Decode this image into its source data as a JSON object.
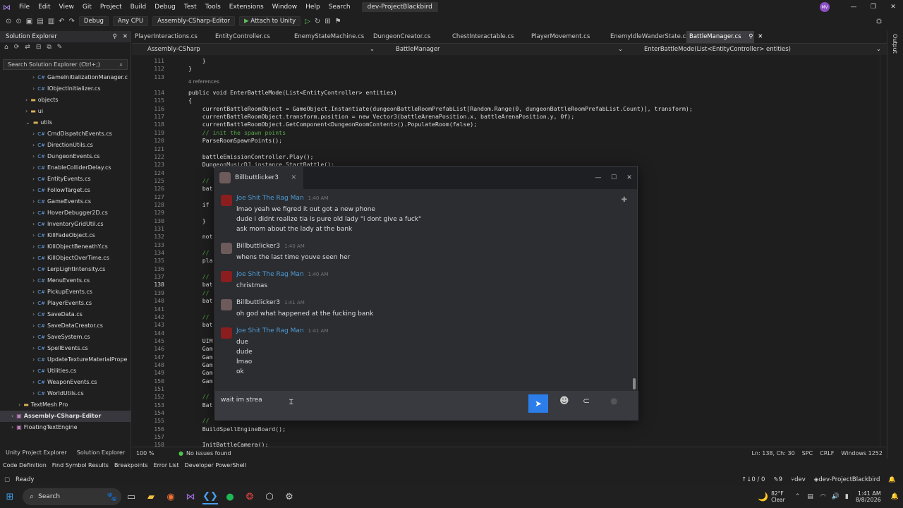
{
  "menu": [
    "File",
    "Edit",
    "View",
    "Git",
    "Project",
    "Build",
    "Debug",
    "Test",
    "Tools",
    "Extensions",
    "Window",
    "Help",
    "Search"
  ],
  "window": {
    "title": "dev-ProjectBlackbird",
    "avatar": "MV"
  },
  "toolbar": {
    "config": "Debug",
    "platform": "Any CPU",
    "project": "Assembly-CSharp-Editor",
    "attach": "Attach to Unity"
  },
  "explorer": {
    "title": "Solution Explorer",
    "search_placeholder": "Search Solution Explorer (Ctrl+;)",
    "items": [
      {
        "label": "GameInitializationManager.c",
        "kind": "cs",
        "indent": 4
      },
      {
        "label": "IObjectInitializer.cs",
        "kind": "cs",
        "indent": 4
      },
      {
        "label": "objects",
        "kind": "folder",
        "indent": 3
      },
      {
        "label": "ui",
        "kind": "folder",
        "indent": 3
      },
      {
        "label": "utils",
        "kind": "folder",
        "indent": 3
      },
      {
        "label": "CmdDispatchEvents.cs",
        "kind": "cs",
        "indent": 4
      },
      {
        "label": "DirectionUtils.cs",
        "kind": "cs",
        "indent": 4
      },
      {
        "label": "DungeonEvents.cs",
        "kind": "cs",
        "indent": 4
      },
      {
        "label": "EnableColliderDelay.cs",
        "kind": "cs",
        "indent": 4
      },
      {
        "label": "EntityEvents.cs",
        "kind": "cs",
        "indent": 4
      },
      {
        "label": "FollowTarget.cs",
        "kind": "cs",
        "indent": 4
      },
      {
        "label": "GameEvents.cs",
        "kind": "cs",
        "indent": 4
      },
      {
        "label": "HoverDebugger2D.cs",
        "kind": "cs",
        "indent": 4
      },
      {
        "label": "InventoryGridUtil.cs",
        "kind": "cs",
        "indent": 4
      },
      {
        "label": "KillFadeObject.cs",
        "kind": "cs",
        "indent": 4
      },
      {
        "label": "KillObjectBeneathY.cs",
        "kind": "cs",
        "indent": 4
      },
      {
        "label": "KillObjectOverTime.cs",
        "kind": "cs",
        "indent": 4
      },
      {
        "label": "LerpLightIntensity.cs",
        "kind": "cs",
        "indent": 4
      },
      {
        "label": "MenuEvents.cs",
        "kind": "cs",
        "indent": 4
      },
      {
        "label": "PickupEvents.cs",
        "kind": "cs",
        "indent": 4
      },
      {
        "label": "PlayerEvents.cs",
        "kind": "cs",
        "indent": 4
      },
      {
        "label": "SaveData.cs",
        "kind": "cs",
        "indent": 4
      },
      {
        "label": "SaveDataCreator.cs",
        "kind": "cs",
        "indent": 4
      },
      {
        "label": "SaveSystem.cs",
        "kind": "cs",
        "indent": 4
      },
      {
        "label": "SpellEvents.cs",
        "kind": "cs",
        "indent": 4
      },
      {
        "label": "UpdateTextureMaterialPrope",
        "kind": "cs",
        "indent": 4
      },
      {
        "label": "Utilities.cs",
        "kind": "cs",
        "indent": 4
      },
      {
        "label": "WeaponEvents.cs",
        "kind": "cs",
        "indent": 4
      },
      {
        "label": "WorldUtils.cs",
        "kind": "cs",
        "indent": 4
      },
      {
        "label": "TextMesh Pro",
        "kind": "folder",
        "indent": 2
      },
      {
        "label": "Assembly-CSharp-Editor",
        "kind": "proj",
        "indent": 1
      },
      {
        "label": "FloatingTextEngine",
        "kind": "proj",
        "indent": 1
      }
    ],
    "bottom_tabs": [
      "Unity Project Explorer",
      "Solution Explorer"
    ]
  },
  "tabs": [
    "PlayerInteractions.cs",
    "EntityController.cs",
    "EnemyStateMachine.cs",
    "DungeonCreator.cs",
    "ChestInteractable.cs",
    "PlayerMovement.cs",
    "EnemyIdleWanderState.cs",
    "BattleManager.cs"
  ],
  "nav": {
    "project": "Assembly-CSharp",
    "class": "BattleManager",
    "member": "EnterBattleMode(List<EntityController> entities)"
  },
  "code": {
    "refs": "4 references",
    "lines": [
      {
        "n": "111",
        "t": "    }"
      },
      {
        "n": "112",
        "t": "}"
      },
      {
        "n": "113",
        "t": ""
      },
      {
        "n": "114",
        "t": "public void EnterBattleMode(List<EntityController> entities)"
      },
      {
        "n": "115",
        "t": "{"
      },
      {
        "n": "116",
        "t": "    currentBattleRoomObject = GameObject.Instantiate(dungeonBattleRoomPrefabList[Random.Range(0, dungeonBattleRoomPrefabList.Count)], transform);"
      },
      {
        "n": "117",
        "t": "    currentBattleRoomObject.transform.position = new Vector3(battleArenaPosition.x, battleArenaPosition.y, 0f);"
      },
      {
        "n": "118",
        "t": "    currentBattleRoomObject.GetComponent<DungeonRoomContent>().PopulateRoom(false);"
      },
      {
        "n": "119",
        "t": "    // init the spawn points"
      },
      {
        "n": "120",
        "t": "    ParseRoomSpawnPoints();"
      },
      {
        "n": "121",
        "t": ""
      },
      {
        "n": "122",
        "t": "    battleEmissionController.Play();"
      },
      {
        "n": "123",
        "t": "    DungeonMusicDJ.instance.StartBattle();"
      },
      {
        "n": "124",
        "t": ""
      },
      {
        "n": "125",
        "t": "    //"
      },
      {
        "n": "126",
        "t": "    bat"
      },
      {
        "n": "127",
        "t": ""
      },
      {
        "n": "128",
        "t": "    if"
      },
      {
        "n": "129",
        "t": ""
      },
      {
        "n": "130",
        "t": "    }"
      },
      {
        "n": "131",
        "t": ""
      },
      {
        "n": "132",
        "t": "    not"
      },
      {
        "n": "133",
        "t": ""
      },
      {
        "n": "134",
        "t": "    //"
      },
      {
        "n": "135",
        "t": "    pla"
      },
      {
        "n": "136",
        "t": ""
      },
      {
        "n": "137",
        "t": "    //"
      },
      {
        "n": "138",
        "t": "    bat"
      },
      {
        "n": "139",
        "t": "    //"
      },
      {
        "n": "140",
        "t": "    bat"
      },
      {
        "n": "141",
        "t": ""
      },
      {
        "n": "142",
        "t": "    //"
      },
      {
        "n": "143",
        "t": "    bat"
      },
      {
        "n": "144",
        "t": ""
      },
      {
        "n": "145",
        "t": "    UIM"
      },
      {
        "n": "146",
        "t": "    Gam"
      },
      {
        "n": "147",
        "t": "    Gam"
      },
      {
        "n": "148",
        "t": "    Gam"
      },
      {
        "n": "149",
        "t": "    Gam"
      },
      {
        "n": "150",
        "t": "    Gam"
      },
      {
        "n": "151",
        "t": ""
      },
      {
        "n": "152",
        "t": "    //"
      },
      {
        "n": "153",
        "t": "    Bat"
      },
      {
        "n": "154",
        "t": ""
      },
      {
        "n": "155",
        "t": "    //"
      },
      {
        "n": "156",
        "t": "    BuildSpellEngineBoard();"
      },
      {
        "n": "157",
        "t": ""
      },
      {
        "n": "158",
        "t": "    InitBattleCamera();"
      }
    ]
  },
  "editor_status": {
    "zoom": "100 %",
    "issues": "No issues found",
    "pos": "Ln: 138, Ch: 30",
    "enc": "SPC",
    "eol": "CRLF",
    "platform": "Windows 1252"
  },
  "tool_tabs": [
    "Code Definition",
    "Find Symbol Results",
    "Breakpoints",
    "Error List",
    "Developer PowerShell"
  ],
  "statusbar": {
    "left": "Ready",
    "errors": "0 / 0",
    "changes": "9",
    "branch": "dev",
    "repo": "dev-ProjectBlackbird"
  },
  "right_panel": "Output",
  "chat": {
    "title": "Billbuttlicker3",
    "groups": [
      {
        "author": "Joe Shit The Rag Man",
        "time": "1:40 AM",
        "color": "#4e9bd6",
        "lines": [
          "lmao yeah we figred it out got a new phone",
          "dude i didnt realize tia is pure old lady \"i dont give a fuck\"",
          "ask mom about the lady at the bank"
        ]
      },
      {
        "author": "Billbuttlicker3",
        "time": "1:40 AM",
        "color": "#dbdee1",
        "lines": [
          "whens the last time youve seen her"
        ]
      },
      {
        "author": "Joe Shit The Rag Man",
        "time": "1:40 AM",
        "color": "#4e9bd6",
        "lines": [
          "christmas"
        ]
      },
      {
        "author": "Billbuttlicker3",
        "time": "1:41 AM",
        "color": "#dbdee1",
        "lines": [
          "oh god what happened at the fucking bank"
        ]
      },
      {
        "author": "Joe Shit The Rag Man",
        "time": "1:41 AM",
        "color": "#4e9bd6",
        "lines": [
          "due",
          "dude",
          "lmao",
          "ok"
        ]
      }
    ],
    "input_value": "wait im strea"
  },
  "taskbar": {
    "search": "Search",
    "weather_temp": "82°F",
    "weather_desc": "Clear",
    "time": "1:41 AM",
    "date": "8/8/2026"
  }
}
